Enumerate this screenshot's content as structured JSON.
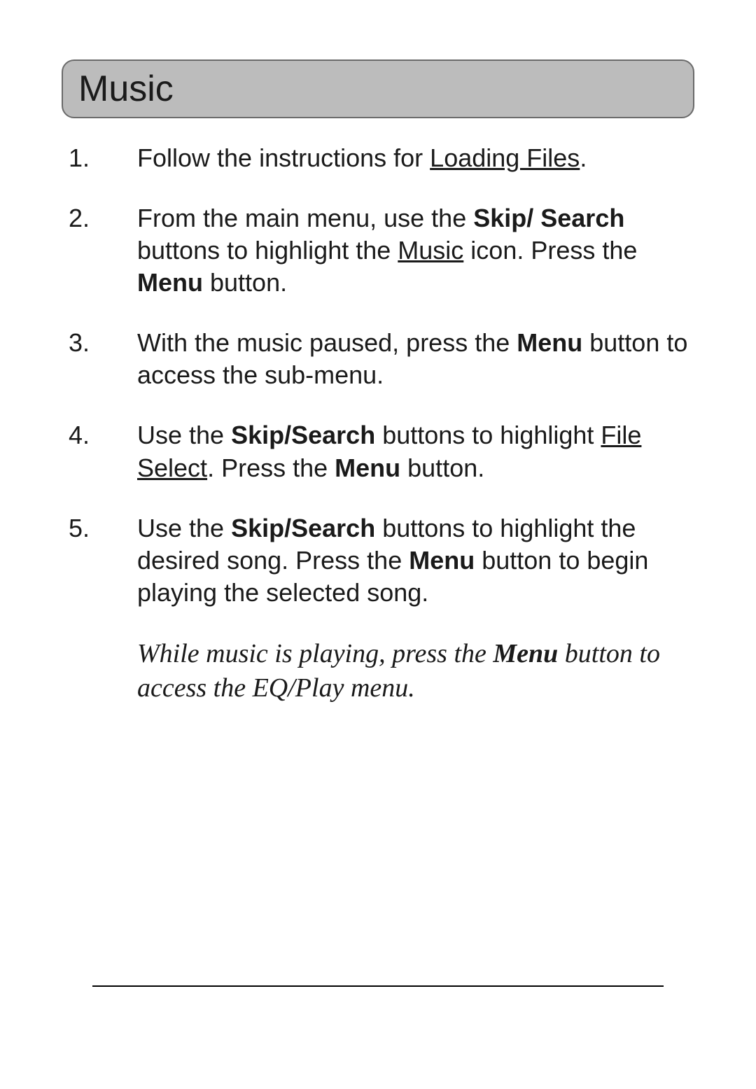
{
  "header": {
    "title": "Music"
  },
  "steps": [
    {
      "segments": [
        {
          "text": "Follow the instructions for "
        },
        {
          "text": "Loading Files",
          "underline": true
        },
        {
          "text": "."
        }
      ]
    },
    {
      "segments": [
        {
          "text": "From the main menu, use the "
        },
        {
          "text": "Skip/ Search",
          "bold": true
        },
        {
          "text": " buttons to highlight the "
        },
        {
          "text": "Music",
          "underline": true
        },
        {
          "text": " icon. Press the "
        },
        {
          "text": "Menu",
          "bold": true
        },
        {
          "text": " button."
        }
      ]
    },
    {
      "segments": [
        {
          "text": "With the music paused, press the "
        },
        {
          "text": "Menu",
          "bold": true
        },
        {
          "text": " button to access the sub-menu."
        }
      ]
    },
    {
      "segments": [
        {
          "text": "Use the "
        },
        {
          "text": "Skip/Search",
          "bold": true
        },
        {
          "text": " buttons to highlight "
        },
        {
          "text": "File Select",
          "underline": true
        },
        {
          "text": ". Press the "
        },
        {
          "text": "Menu",
          "bold": true
        },
        {
          "text": " button."
        }
      ]
    },
    {
      "segments": [
        {
          "text": "Use the "
        },
        {
          "text": "Skip/Search",
          "bold": true
        },
        {
          "text": " buttons to highlight the desired song. Press the "
        },
        {
          "text": "Menu",
          "bold": true
        },
        {
          "text": " button to begin playing the selected song."
        }
      ]
    }
  ],
  "note": {
    "segments": [
      {
        "text": "While music is playing, press the "
      },
      {
        "text": "Menu",
        "bold": true
      },
      {
        "text": " button to access the EQ/Play menu."
      }
    ]
  }
}
